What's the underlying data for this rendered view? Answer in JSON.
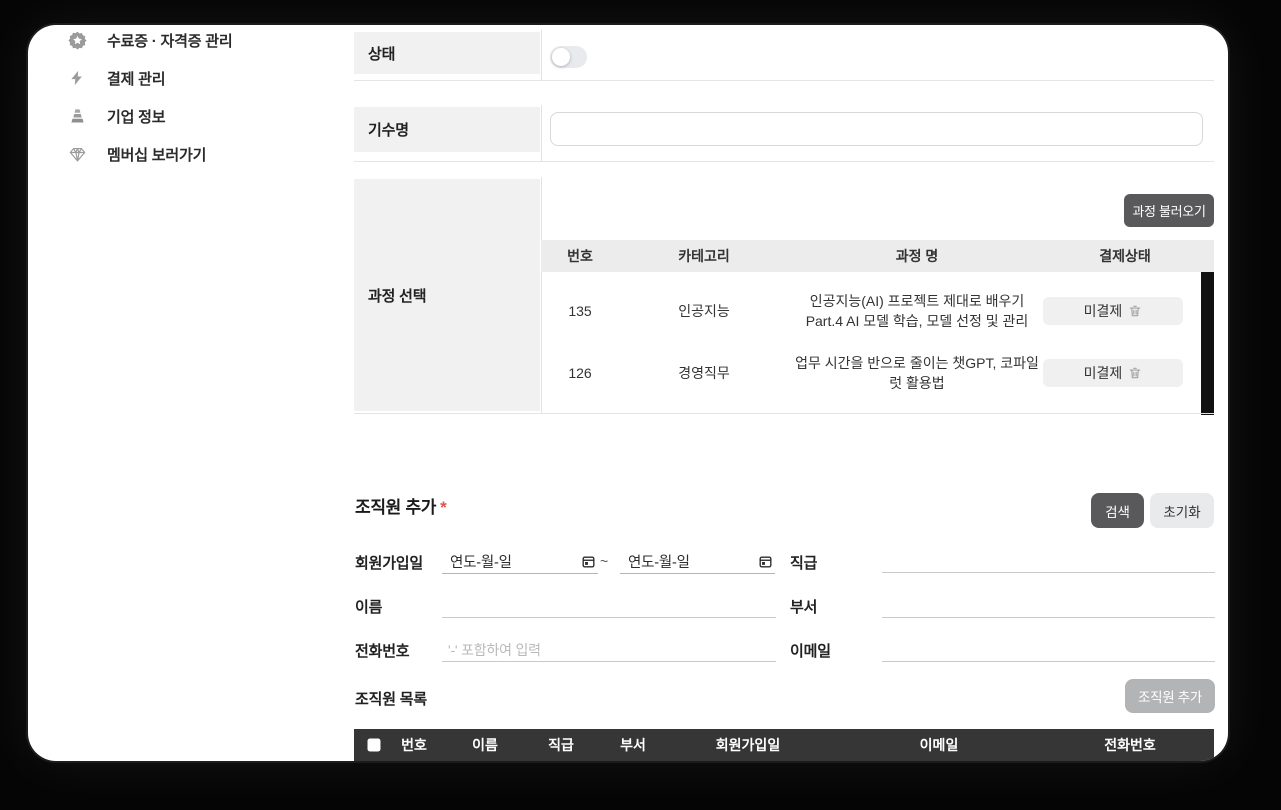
{
  "sidebar": {
    "items": [
      {
        "label": "수료증 · 자격증 관리",
        "icon": "certificate-badge"
      },
      {
        "label": "결제 관리",
        "icon": "lightning"
      },
      {
        "label": "기업 정보",
        "icon": "building"
      },
      {
        "label": "멤버십 보러가기",
        "icon": "diamond"
      }
    ]
  },
  "form": {
    "status": {
      "label": "상태",
      "toggle_on": false
    },
    "cohort": {
      "label": "기수명",
      "value": ""
    },
    "course_select": {
      "label": "과정 선택",
      "load_button": "과정 불러오기",
      "table": {
        "headers": [
          "번호",
          "카테고리",
          "과정 명",
          "결제상태"
        ],
        "rows": [
          {
            "no": "135",
            "category": "인공지능",
            "name": "인공지능(AI) 프로젝트 제대로 배우기 Part.4 AI 모델 학습, 모델 선정 및 관리",
            "payment_status": "미결제"
          },
          {
            "no": "126",
            "category": "경영직무",
            "name": "업무 시간을 반으로 줄이는 챗GPT, 코파일럿 활용법",
            "payment_status": "미결제"
          }
        ]
      }
    }
  },
  "members": {
    "title": "조직원 추가",
    "required_mark": "*",
    "search_button": "검색",
    "reset_button": "초기화",
    "fields": {
      "join_date": {
        "label": "회원가입일",
        "placeholder": "연도-월-일",
        "separator": "~"
      },
      "name": {
        "label": "이름",
        "value": ""
      },
      "phone": {
        "label": "전화번호",
        "placeholder": "'-' 포함하여 입력",
        "value": ""
      },
      "position": {
        "label": "직급",
        "value": ""
      },
      "department": {
        "label": "부서",
        "value": ""
      },
      "email": {
        "label": "이메일",
        "value": ""
      }
    },
    "list": {
      "label": "조직원 목록",
      "add_button": "조직원 추가",
      "headers": [
        "번호",
        "이름",
        "직급",
        "부서",
        "회원가입일",
        "이메일",
        "전화번호"
      ]
    }
  },
  "colors": {
    "backdrop": "#050505",
    "card": "#ffffff",
    "label_cell": "#f1f1f2",
    "dark_button": "#59595b",
    "light_button": "#e9eaeb",
    "disabled_button": "#b3b4b6",
    "table_header_light": "#ececec",
    "table_header_dark": "#363636",
    "payment_chip": "#f0f0f1",
    "required_asterisk": "#e05252",
    "scrollbar": "#111111"
  }
}
